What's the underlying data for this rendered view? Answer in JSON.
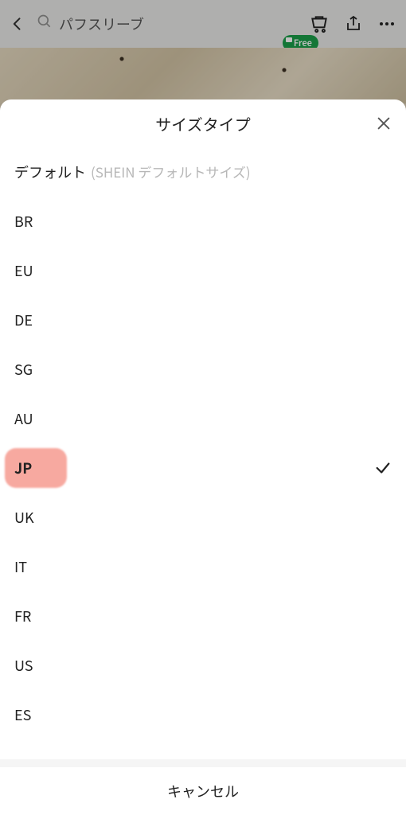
{
  "topbar": {
    "search_text": "パフスリーブ",
    "free_badge": "Free"
  },
  "sheet": {
    "title": "サイズタイプ",
    "cancel": "キャンセル",
    "options": [
      {
        "main": "デフォルト",
        "sub": "(SHEIN デフォルトサイズ)",
        "selected": false
      },
      {
        "main": "BR",
        "sub": "",
        "selected": false
      },
      {
        "main": "EU",
        "sub": "",
        "selected": false
      },
      {
        "main": "DE",
        "sub": "",
        "selected": false
      },
      {
        "main": "SG",
        "sub": "",
        "selected": false
      },
      {
        "main": "AU",
        "sub": "",
        "selected": false
      },
      {
        "main": "JP",
        "sub": "",
        "selected": true
      },
      {
        "main": "UK",
        "sub": "",
        "selected": false
      },
      {
        "main": "IT",
        "sub": "",
        "selected": false
      },
      {
        "main": "FR",
        "sub": "",
        "selected": false
      },
      {
        "main": "US",
        "sub": "",
        "selected": false
      },
      {
        "main": "ES",
        "sub": "",
        "selected": false
      }
    ]
  },
  "icons": {
    "back": "chevron-left",
    "search": "magnifier",
    "cart": "cart",
    "share": "share",
    "more": "ellipsis",
    "close": "x",
    "check": "check"
  }
}
